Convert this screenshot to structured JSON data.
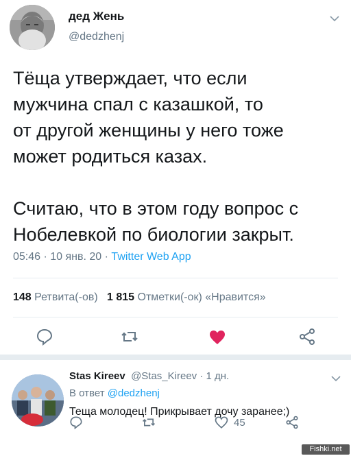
{
  "tweet": {
    "author": {
      "name": "дед Жень",
      "handle": "@dedzhenj"
    },
    "text_lines": [
      "Тёща утверждает, что если",
      "мужчина спал с казашкой, то",
      "от другой женщины у него тоже",
      "может родиться казах.",
      "Считаю, что в этом году вопрос с",
      "Нобелевкой по биологии закрыт."
    ],
    "time": "05:46",
    "date": "10 янв. 20",
    "source": "Twitter Web App",
    "retweets_count": "148",
    "retweets_label": "Ретвита(-ов)",
    "likes_count": "1 815",
    "likes_label": "Отметки(-ок) «Нравится»",
    "liked": true,
    "colors": {
      "like_active": "#e0245e",
      "link": "#1da1f2",
      "secondary_text": "#657786"
    }
  },
  "reply": {
    "author_name": "Stas Kireev",
    "handle": "@Stas_Kireev",
    "age": "1 дн.",
    "reply_to_prefix": "В ответ",
    "reply_to_handle": "@dedzhenj",
    "text": "Теща молодец! Прикрывает дочу заранее;)",
    "likes_count": "45"
  },
  "icons": {
    "dropdown": "chevron-down-icon",
    "reply": "reply-bubble-icon",
    "retweet": "retweet-icon",
    "like": "heart-icon",
    "share": "share-icon"
  },
  "watermark": "Fishki.net"
}
